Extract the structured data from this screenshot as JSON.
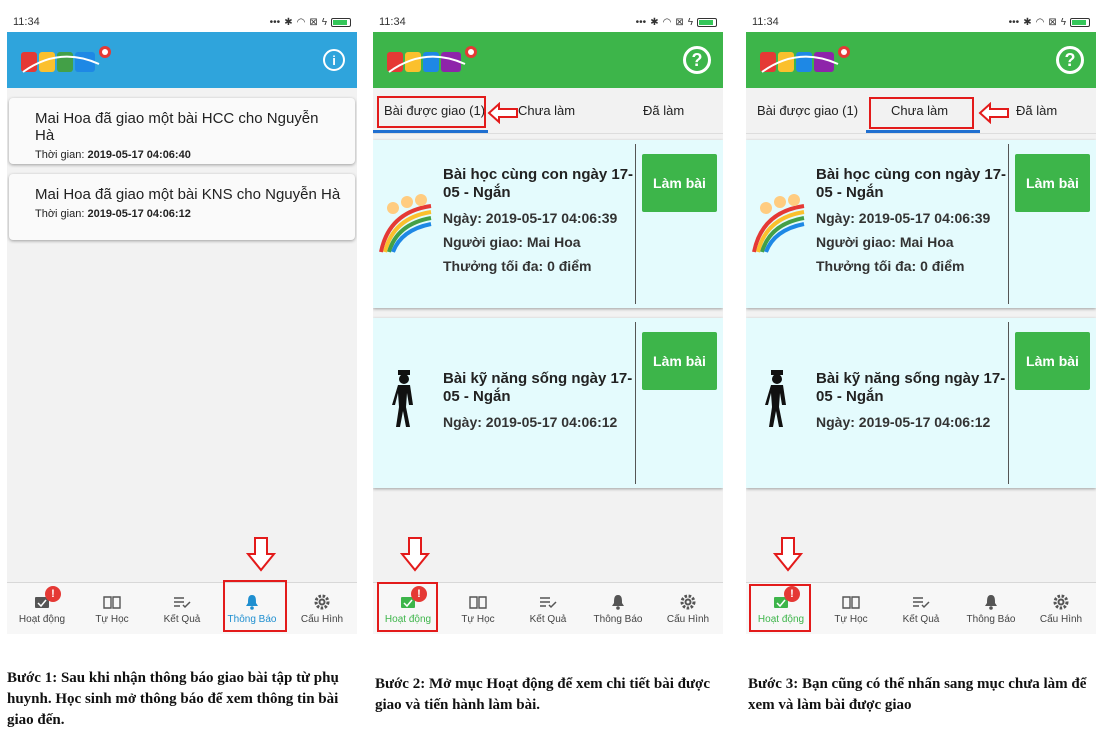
{
  "screens": [
    {
      "status_time": "11:34",
      "notifications": [
        {
          "title": "Mai Hoa đã giao một bài HCC cho Nguyễn Hà",
          "time_label": "Thời gian:",
          "time_value": "2019-05-17 04:06:40"
        },
        {
          "title": "Mai Hoa đã giao một bài KNS cho Nguyễn Hà",
          "time_label": "Thời gian:",
          "time_value": "2019-05-17 04:06:12"
        }
      ]
    },
    {
      "status_time": "11:34",
      "tabs": [
        "Bài được giao (1)",
        "Chưa làm",
        "Đã làm"
      ]
    },
    {
      "status_time": "11:34",
      "tabs": [
        "Bài được giao (1)",
        "Chưa làm",
        "Đã làm"
      ]
    }
  ],
  "tasks": [
    {
      "title": "Bài học cùng con ngày 17-05 - Ngắn",
      "date": "Ngày: 2019-05-17 04:06:39",
      "giver": "Người giao: Mai Hoa",
      "reward": "Thưởng tối đa: 0 điểm",
      "button": "Làm bài"
    },
    {
      "title": "Bài kỹ năng sống ngày 17-05 - Ngắn",
      "date": "Ngày: 2019-05-17 04:06:12",
      "button": "Làm bài"
    }
  ],
  "nav": {
    "items": [
      "Hoạt động",
      "Tự Học",
      "Kết Quả",
      "Thông Báo",
      "Cấu Hình"
    ],
    "badge": "!"
  },
  "info_icon": "i",
  "help_icon": "?",
  "captions": [
    "Bước 1: Sau khi nhận thông báo giao bài tập từ phụ huynh. Học sinh mở thông báo để xem thông tin bài giao đến.",
    "Bước 2: Mở mục Hoạt động để xem chi tiết bài được giao và tiến hành làm bài.",
    "Bước 3: Bạn cũng có thể nhấn sang mục chưa làm để xem và làm bài được giao"
  ],
  "colors": {
    "appbar_blue": "#2fa4dc",
    "appbar_green": "#3db54a",
    "highlight_red": "#e31b1b",
    "card_cyan": "#e4fbfd",
    "tab_underline": "#1f6fd0"
  }
}
